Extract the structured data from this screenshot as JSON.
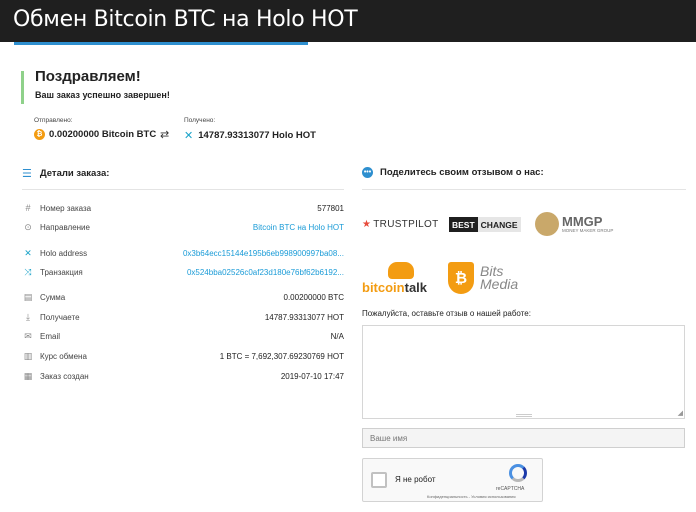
{
  "header": {
    "title": "Обмен Bitcoin BTC на Holo HOT"
  },
  "congrats": {
    "title": "Поздравляем!",
    "subtitle": "Ваш заказ успешно завершен!"
  },
  "transfer": {
    "sent_label": "Отправлено:",
    "sent_value": "0.00200000 Bitcoin BTC",
    "received_label": "Получено:",
    "received_value": "14787.93313077 Holo HOT"
  },
  "details": {
    "title": "Детали заказа:",
    "rows": [
      {
        "icon": "hash-icon",
        "label": "Номер заказа",
        "value": "577801",
        "link": false
      },
      {
        "icon": "direction-icon",
        "label": "Направление",
        "value": "Bitcoin BTC на Holo HOT",
        "link": true
      },
      {
        "icon": "holo-icon",
        "label": "Holo address",
        "value": "0x3b64ecc15144e195b6eb998900997ba08...",
        "link": true
      },
      {
        "icon": "shuffle-icon",
        "label": "Транзакция",
        "value": "0x524bba02526c0af23d180e76bf62b6192...",
        "link": true
      },
      {
        "icon": "wallet-icon",
        "label": "Сумма",
        "value": "0.00200000 BTC",
        "link": false
      },
      {
        "icon": "download-icon",
        "label": "Получаете",
        "value": "14787.93313077 HOT",
        "link": false
      },
      {
        "icon": "email-icon",
        "label": "Email",
        "value": "N/A",
        "link": false
      },
      {
        "icon": "chart-icon",
        "label": "Курс обмена",
        "value": "1 BTC = 7,692,307.69230769 HOT",
        "link": false
      },
      {
        "icon": "calendar-icon",
        "label": "Заказ создан",
        "value": "2019-07-10 17:47",
        "link": false
      }
    ]
  },
  "share": {
    "title": "Поделитесь своим отзывом о нас:",
    "logos": {
      "trustpilot": "TRUSTPILOT",
      "bestchange_a": "BEST",
      "bestchange_b": "CHANGE",
      "mmgp": "MMGP",
      "mmgp_sub": "MONEY MAKER GROUP",
      "bitcointalk_a": "bitcoin",
      "bitcointalk_b": "talk",
      "bitsmedia_a": "Bits",
      "bitsmedia_b": "Media"
    },
    "feedback_label": "Пожалуйста, оставьте отзыв о нашей работе:",
    "name_placeholder": "Ваше имя",
    "captcha_label": "Я не робот",
    "captcha_brand": "reCAPTCHA",
    "captcha_terms": "Конфиденциальность - Условия использования"
  }
}
